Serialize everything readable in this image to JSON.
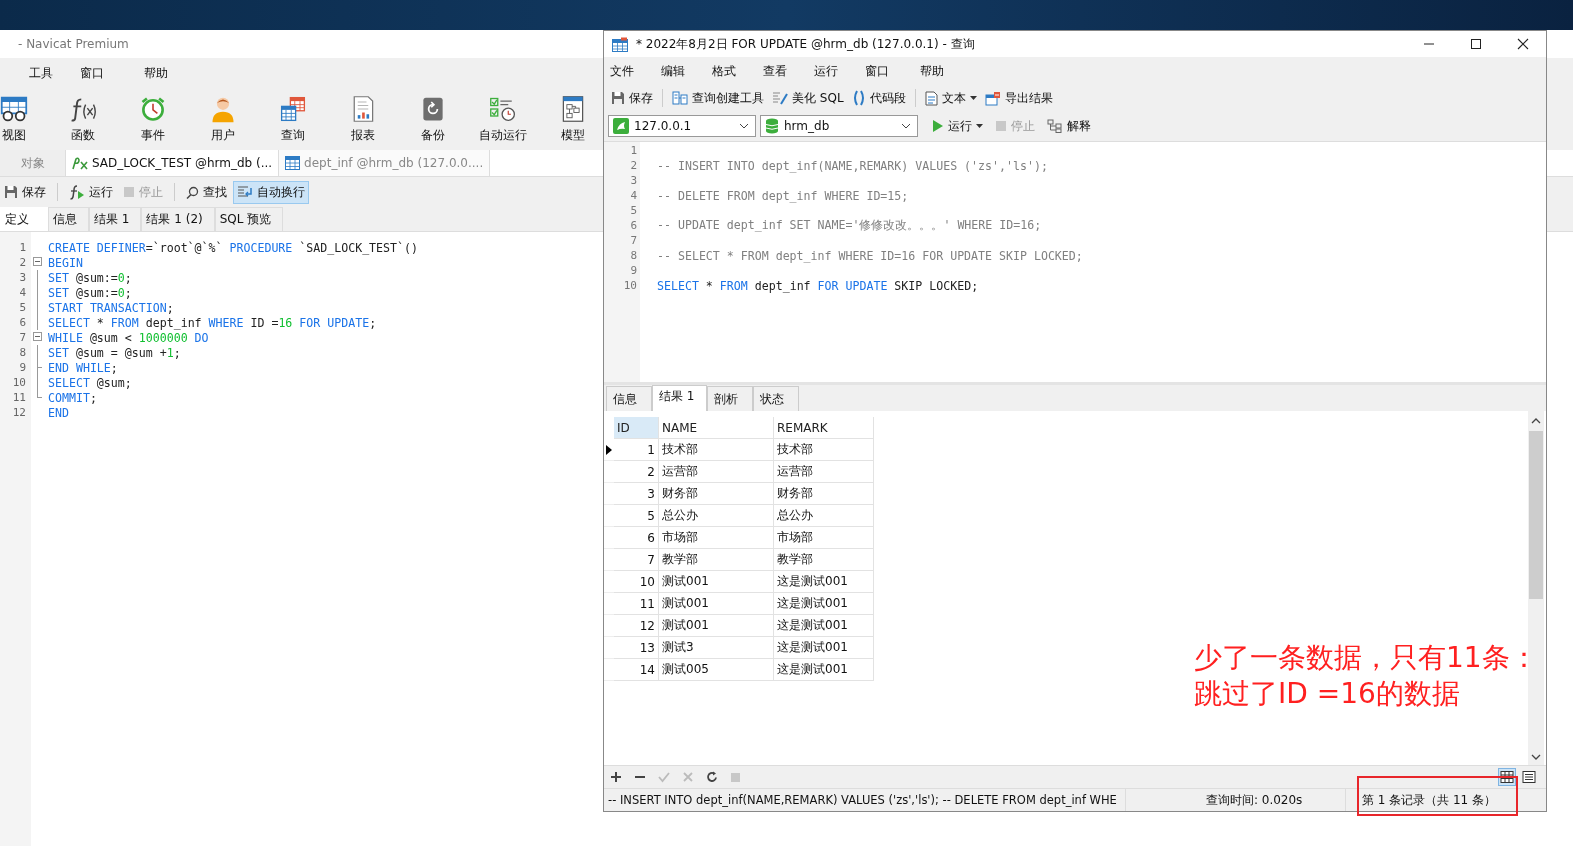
{
  "left_window": {
    "title": "- Navicat Premium",
    "menu": [
      "工具",
      "窗口",
      "帮助"
    ],
    "toolbar": [
      "视图",
      "函数",
      "事件",
      "用户",
      "查询",
      "报表",
      "备份",
      "自动运行",
      "模型"
    ],
    "tabs": [
      {
        "label": "对象",
        "selected": false
      },
      {
        "label": "SAD_LOCK_TEST @hrm_db (...",
        "selected": true
      },
      {
        "label": "dept_inf @hrm_db (127.0.0....",
        "selected": false
      }
    ],
    "editor_toolbar": [
      {
        "label": "保存",
        "disabled": false,
        "on": false
      },
      {
        "label": "运行",
        "disabled": false,
        "on": false
      },
      {
        "label": "停止",
        "disabled": true,
        "on": false
      },
      {
        "label": "查找",
        "disabled": false,
        "on": false
      },
      {
        "label": "自动换行",
        "disabled": false,
        "on": true
      }
    ],
    "subtabs": [
      {
        "label": "定义",
        "selected": true
      },
      {
        "label": "信息",
        "selected": false
      },
      {
        "label": "结果 1",
        "selected": false
      },
      {
        "label": "结果 1 (2)",
        "selected": false
      },
      {
        "label": "SQL 预览",
        "selected": false
      }
    ],
    "code": [
      {
        "number": "1",
        "collapsible": false,
        "in_block": false,
        "block_end": false,
        "tokens": [
          {
            "kind": "keyword",
            "text": "CREATE DEFINER"
          },
          {
            "kind": "plain",
            "text": "=`root`@`%` "
          },
          {
            "kind": "keyword",
            "text": "PROCEDURE"
          },
          {
            "kind": "plain",
            "text": " `SAD_LOCK_TEST`()"
          }
        ]
      },
      {
        "number": "2",
        "collapsible": true,
        "in_block": true,
        "block_end": false,
        "tokens": [
          {
            "kind": "keyword",
            "text": "BEGIN"
          }
        ]
      },
      {
        "number": "3",
        "collapsible": false,
        "in_block": true,
        "block_end": false,
        "tokens": [
          {
            "kind": "keyword",
            "text": "SET"
          },
          {
            "kind": "plain",
            "text": " @sum:="
          },
          {
            "kind": "number",
            "text": "0"
          },
          {
            "kind": "plain",
            "text": ";"
          }
        ]
      },
      {
        "number": "4",
        "collapsible": false,
        "in_block": true,
        "block_end": false,
        "tokens": [
          {
            "kind": "keyword",
            "text": "SET"
          },
          {
            "kind": "plain",
            "text": " @sum:="
          },
          {
            "kind": "number",
            "text": "0"
          },
          {
            "kind": "plain",
            "text": ";"
          }
        ]
      },
      {
        "number": "5",
        "collapsible": false,
        "in_block": true,
        "block_end": false,
        "tokens": [
          {
            "kind": "keyword",
            "text": "START TRANSACTION"
          },
          {
            "kind": "plain",
            "text": ";"
          }
        ]
      },
      {
        "number": "6",
        "collapsible": false,
        "in_block": true,
        "block_end": false,
        "tokens": [
          {
            "kind": "keyword",
            "text": "SELECT"
          },
          {
            "kind": "plain",
            "text": " * "
          },
          {
            "kind": "keyword",
            "text": "FROM"
          },
          {
            "kind": "plain",
            "text": " dept_inf "
          },
          {
            "kind": "keyword",
            "text": "WHERE"
          },
          {
            "kind": "plain",
            "text": " ID ="
          },
          {
            "kind": "number",
            "text": "16"
          },
          {
            "kind": "keyword",
            "text": " FOR UPDATE"
          },
          {
            "kind": "plain",
            "text": ";"
          }
        ]
      },
      {
        "number": "7",
        "collapsible": true,
        "in_block": true,
        "block_end": false,
        "tokens": [
          {
            "kind": "keyword",
            "text": "WHILE"
          },
          {
            "kind": "plain",
            "text": " @sum < "
          },
          {
            "kind": "number",
            "text": "1000000"
          },
          {
            "kind": "keyword",
            "text": " DO"
          }
        ]
      },
      {
        "number": "8",
        "collapsible": false,
        "in_block": true,
        "block_end": false,
        "tokens": [
          {
            "kind": "keyword",
            "text": "SET"
          },
          {
            "kind": "plain",
            "text": " @sum = @sum +"
          },
          {
            "kind": "number",
            "text": "1"
          },
          {
            "kind": "plain",
            "text": ";"
          }
        ]
      },
      {
        "number": "9",
        "collapsible": false,
        "in_block": true,
        "block_end": true,
        "tokens": [
          {
            "kind": "keyword",
            "text": "END WHILE"
          },
          {
            "kind": "plain",
            "text": ";"
          }
        ]
      },
      {
        "number": "10",
        "collapsible": false,
        "in_block": true,
        "block_end": false,
        "tokens": [
          {
            "kind": "keyword",
            "text": "SELECT"
          },
          {
            "kind": "plain",
            "text": " @sum;"
          }
        ]
      },
      {
        "number": "11",
        "collapsible": false,
        "in_block": true,
        "block_end": true,
        "tokens": [
          {
            "kind": "keyword",
            "text": "COMMIT"
          },
          {
            "kind": "plain",
            "text": ";"
          }
        ]
      },
      {
        "number": "12",
        "collapsible": false,
        "in_block": false,
        "block_end": false,
        "tokens": [
          {
            "kind": "keyword",
            "text": "END"
          }
        ]
      }
    ]
  },
  "right_window": {
    "title": "* 2022年8月2日 FOR UPDATE @hrm_db (127.0.0.1) - 查询",
    "menu": [
      "文件",
      "编辑",
      "格式",
      "查看",
      "运行",
      "窗口",
      "帮助"
    ],
    "toolbar": [
      {
        "label": "保存",
        "dropdown": false
      },
      {
        "label": "查询创建工具",
        "dropdown": false
      },
      {
        "label": "美化 SQL",
        "dropdown": false
      },
      {
        "label": "代码段",
        "dropdown": false
      },
      {
        "label": "文本",
        "dropdown": true
      },
      {
        "label": "导出结果",
        "dropdown": false
      }
    ],
    "connection": {
      "value": "127.0.0.1"
    },
    "database": {
      "value": "hrm_db"
    },
    "run_bar": [
      {
        "label": "运行",
        "disabled": false,
        "dropdown": true
      },
      {
        "label": "停止",
        "disabled": true,
        "dropdown": false
      },
      {
        "label": "解释",
        "disabled": false,
        "dropdown": false
      }
    ],
    "code": [
      {
        "number": "1"
      },
      {
        "number": "2",
        "tokens": [
          {
            "kind": "comment",
            "text": "-- INSERT INTO dept_inf(NAME,REMARK) VALUES ('zs','ls');"
          }
        ]
      },
      {
        "number": "3"
      },
      {
        "number": "4",
        "tokens": [
          {
            "kind": "comment",
            "text": "-- DELETE FROM dept_inf WHERE ID=15;"
          }
        ]
      },
      {
        "number": "5"
      },
      {
        "number": "6",
        "tokens": [
          {
            "kind": "comment",
            "text": "-- UPDATE dept_inf SET NAME='修修改改。。。' WHERE ID=16;"
          }
        ]
      },
      {
        "number": "7"
      },
      {
        "number": "8",
        "tokens": [
          {
            "kind": "comment",
            "text": "-- SELECT * FROM dept_inf WHERE ID=16 FOR UPDATE SKIP LOCKED;"
          }
        ]
      },
      {
        "number": "9"
      },
      {
        "number": "10",
        "tokens": [
          {
            "kind": "keyword",
            "text": "SELECT"
          },
          {
            "kind": "plain",
            "text": " * "
          },
          {
            "kind": "keyword",
            "text": "FROM"
          },
          {
            "kind": "plain",
            "text": " dept_inf "
          },
          {
            "kind": "keyword",
            "text": "FOR UPDATE"
          },
          {
            "kind": "plain",
            "text": " SKIP LOCKED;"
          }
        ]
      }
    ],
    "result_tabs": [
      {
        "label": "信息",
        "selected": false
      },
      {
        "label": "结果 1",
        "selected": true
      },
      {
        "label": "剖析",
        "selected": false
      },
      {
        "label": "状态",
        "selected": false
      }
    ],
    "table": {
      "columns": [
        {
          "label": "ID",
          "selected": true
        },
        {
          "label": "NAME",
          "selected": false
        },
        {
          "label": "REMARK",
          "selected": false
        }
      ],
      "rows": [
        {
          "id": "1",
          "name": "技术部",
          "remark": "技术部",
          "selected": true
        },
        {
          "id": "2",
          "name": "运营部",
          "remark": "运营部",
          "selected": false
        },
        {
          "id": "3",
          "name": "财务部",
          "remark": "财务部",
          "selected": false
        },
        {
          "id": "5",
          "name": "总公办",
          "remark": "总公办",
          "selected": false
        },
        {
          "id": "6",
          "name": "市场部",
          "remark": "市场部",
          "selected": false
        },
        {
          "id": "7",
          "name": "教学部",
          "remark": "教学部",
          "selected": false
        },
        {
          "id": "10",
          "name": "测试001",
          "remark": "这是测试001",
          "selected": false
        },
        {
          "id": "11",
          "name": "测试001",
          "remark": "这是测试001",
          "selected": false
        },
        {
          "id": "12",
          "name": "测试001",
          "remark": "这是测试001",
          "selected": false
        },
        {
          "id": "13",
          "name": "测试3",
          "remark": "这是测试001",
          "selected": false
        },
        {
          "id": "14",
          "name": "测试005",
          "remark": "这是测试001",
          "selected": false
        }
      ]
    },
    "status_bar": {
      "sql": "-- INSERT INTO dept_inf(NAME,REMARK) VALUES ('zs','ls');  -- DELETE FROM dept_inf WHE",
      "query_time": "查询时间: 0.020s",
      "record": "第 1 条记录（共 11 条）"
    }
  },
  "annotation": {
    "lines": [
      "少了一条数据，只有11条：",
      "跳过了ID =16的数据"
    ]
  }
}
